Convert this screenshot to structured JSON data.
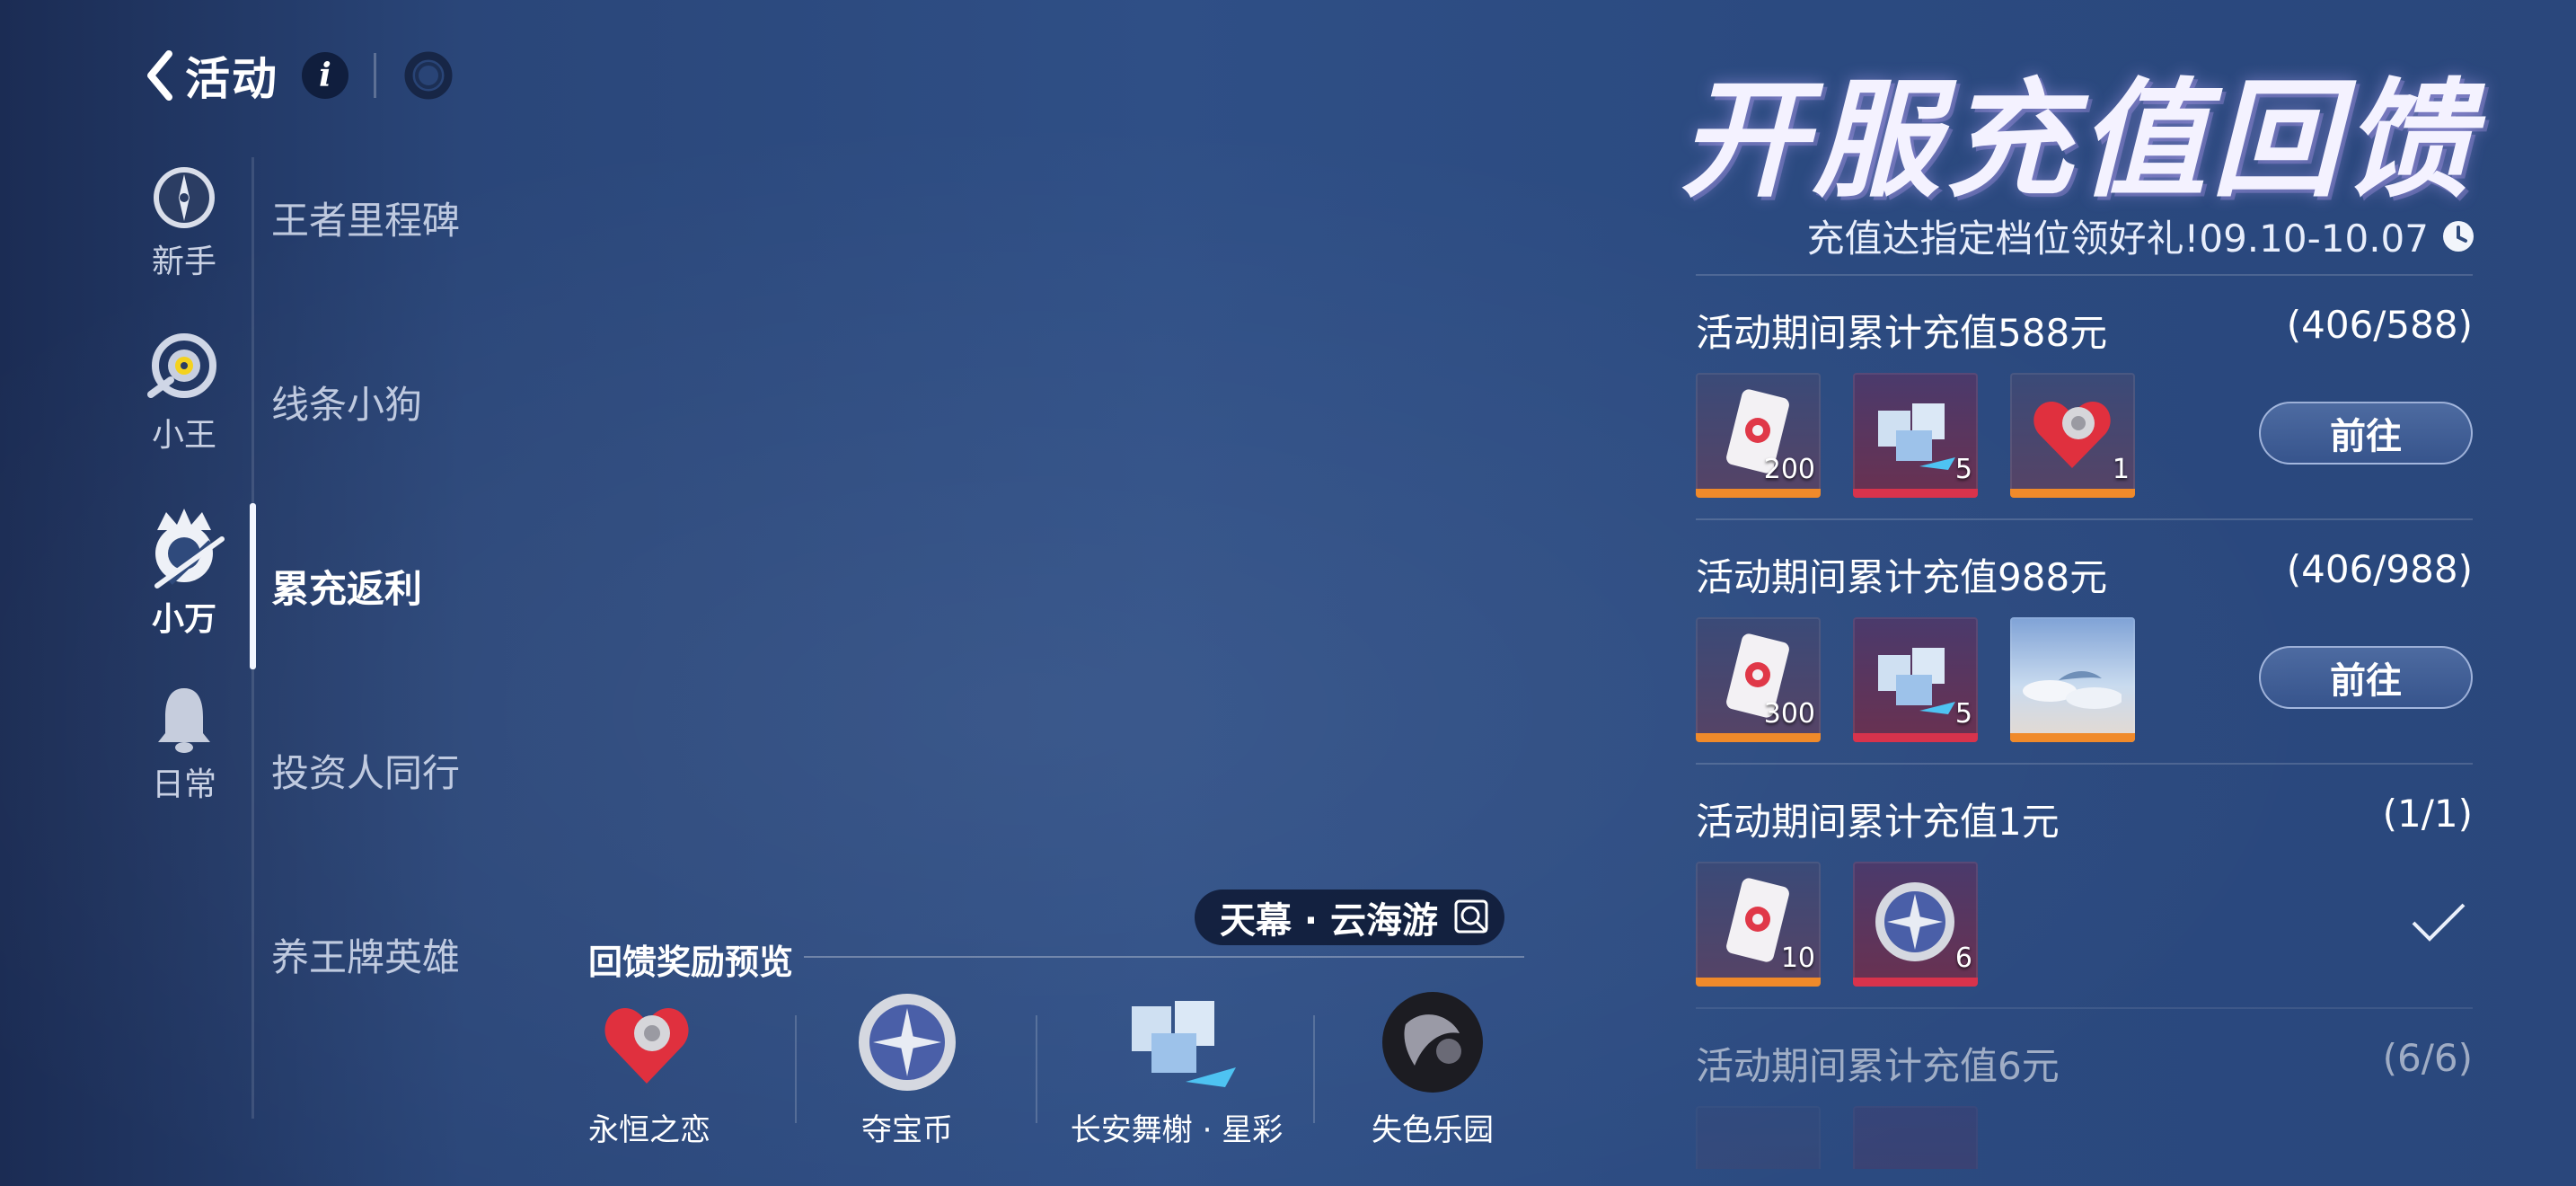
{
  "header": {
    "back_label": "活动",
    "hero_title": "开服充值回馈",
    "hero_subtitle": "充值达指定档位领好礼!09.10-10.07"
  },
  "categories": [
    {
      "label": "新手",
      "icon": "compass-icon"
    },
    {
      "label": "小王",
      "icon": "xiaowang-icon"
    },
    {
      "label": "小万",
      "icon": "xiaowan-icon"
    },
    {
      "label": "日常",
      "icon": "bell-icon"
    }
  ],
  "activities": [
    "王者里程碑",
    "线条小狗",
    "累充返利",
    "投资人同行",
    "养王牌英雄"
  ],
  "active_category": "小万",
  "active_activity": "累充返利",
  "tiers": [
    {
      "title": "活动期间累计充值588元",
      "progress": "(406/588)",
      "action": "前往",
      "items": [
        {
          "icon": "ticket-icon",
          "qty": "200",
          "quality": "orange"
        },
        {
          "icon": "crystal-box-icon",
          "qty": "5",
          "quality": "red"
        },
        {
          "icon": "heart-token-icon",
          "qty": "1",
          "quality": "orange"
        }
      ]
    },
    {
      "title": "活动期间累计充值988元",
      "progress": "(406/988)",
      "action": "前往",
      "items": [
        {
          "icon": "ticket-icon",
          "qty": "300",
          "quality": "orange"
        },
        {
          "icon": "crystal-box-icon",
          "qty": "5",
          "quality": "red"
        },
        {
          "icon": "sky-scene-icon",
          "qty": "",
          "quality": "orange"
        }
      ]
    },
    {
      "title": "活动期间累计充值1元",
      "progress": "(1/1)",
      "action": "",
      "items": [
        {
          "icon": "ticket-icon",
          "qty": "10",
          "quality": "orange"
        },
        {
          "icon": "coin-icon",
          "qty": "6",
          "quality": "red"
        }
      ]
    },
    {
      "title": "活动期间累计充值6元",
      "progress": "(6/6)",
      "action": "",
      "items": []
    }
  ],
  "preview": {
    "skin_name": "天幕 · 云海游",
    "title": "回馈奖励预览",
    "items": [
      {
        "name": "永恒之恋",
        "icon": "heart-token-icon"
      },
      {
        "name": "夺宝币",
        "icon": "coin-icon"
      },
      {
        "name": "长安舞榭 · 星彩",
        "icon": "crystal-box-icon"
      },
      {
        "name": "失色乐园",
        "icon": "dark-orb-icon"
      }
    ]
  },
  "colors": {
    "quality_orange": "#f08a2a",
    "quality_red": "#d8334c",
    "accent_active": "#f2f6ff"
  }
}
